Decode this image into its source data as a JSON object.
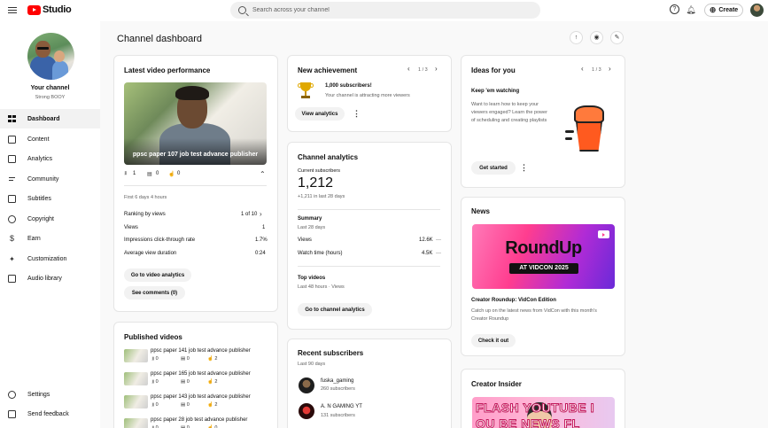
{
  "header": {
    "brand": "Studio",
    "search_placeholder": "Search across your channel",
    "create_label": "Create",
    "brand_color": "#ff0000"
  },
  "sidebar": {
    "channel_title": "Your channel",
    "channel_name": "Strong BOOY",
    "items": [
      {
        "label": "Dashboard",
        "icon": "dashboard-icon"
      },
      {
        "label": "Content",
        "icon": "content-icon"
      },
      {
        "label": "Analytics",
        "icon": "analytics-icon"
      },
      {
        "label": "Community",
        "icon": "community-icon"
      },
      {
        "label": "Subtitles",
        "icon": "subtitles-icon"
      },
      {
        "label": "Copyright",
        "icon": "copyright-icon"
      },
      {
        "label": "Earn",
        "icon": "earn-icon"
      },
      {
        "label": "Customization",
        "icon": "customization-icon"
      },
      {
        "label": "Audio library",
        "icon": "audio-library-icon"
      }
    ],
    "bottom": [
      {
        "label": "Settings",
        "icon": "settings-icon"
      },
      {
        "label": "Send feedback",
        "icon": "feedback-icon"
      }
    ]
  },
  "main": {
    "title": "Channel dashboard"
  },
  "latest_video": {
    "title": "Latest video performance",
    "video_title": "ppsc paper 107 job test advance publisher",
    "views_icon_count": "1",
    "comments_count": "0",
    "likes_count": "0",
    "period": "First 6 days 4 hours",
    "ranking_label": "Ranking by views",
    "ranking_value": "1 of 10",
    "rows": [
      {
        "label": "Views",
        "value": "1"
      },
      {
        "label": "Impressions click-through rate",
        "value": "1.7%"
      },
      {
        "label": "Average view duration",
        "value": "0:24"
      }
    ],
    "go_analytics": "Go to video analytics",
    "see_comments": "See comments (0)"
  },
  "published": {
    "title": "Published videos",
    "items": [
      {
        "title": "ppsc paper 141 job test advance publisher",
        "views": "0",
        "comments": "0",
        "likes": "2"
      },
      {
        "title": "ppsc paper 165 job test advance publisher",
        "views": "0",
        "comments": "0",
        "likes": "2"
      },
      {
        "title": "ppsc paper 143 job test advance publisher",
        "views": "0",
        "comments": "0",
        "likes": "2"
      },
      {
        "title": "ppsc paper 28 job test advance publisher",
        "views": "0",
        "comments": "0",
        "likes": "0"
      }
    ]
  },
  "achievement": {
    "title": "New achievement",
    "pager": "1 / 3",
    "headline": "1,000 subscribers!",
    "desc": "Your channel is attracting more viewers",
    "button": "View analytics"
  },
  "analytics": {
    "title": "Channel analytics",
    "current_label": "Current subscribers",
    "current_value": "1,212",
    "delta": "+1,211 in last 28 days",
    "summary_title": "Summary",
    "summary_period": "Last 28 days",
    "summary_rows": [
      {
        "label": "Views",
        "value": "12.6K",
        "trend": "—"
      },
      {
        "label": "Watch time (hours)",
        "value": "4.5K",
        "trend": "—"
      }
    ],
    "top_title": "Top videos",
    "top_period": "Last 48 hours · Views",
    "button": "Go to channel analytics"
  },
  "subscribers": {
    "title": "Recent subscribers",
    "period": "Last 90 days",
    "items": [
      {
        "name": "fuska_gaming",
        "count": "260 subscribers"
      },
      {
        "name": "A. N GAMING YT",
        "count": "131 subscribers"
      }
    ]
  },
  "ideas": {
    "title": "Ideas for you",
    "pager": "1 / 3",
    "headline": "Keep 'em watching",
    "desc_1": "Want to learn how to keep your",
    "desc_2": "viewers engaged? Learn the power",
    "desc_3": "of scheduling and creating playlists",
    "button": "Get started"
  },
  "news": {
    "title": "News",
    "image_title": "RoundUp",
    "image_sub": "AT VIDCON 2025",
    "headline": "Creator Roundup: VidCon Edition",
    "desc_1": "Catch up on the latest news from VidCon with this month's",
    "desc_2": "Creator Roundup",
    "button": "Check it out"
  },
  "insider": {
    "title": "Creator Insider",
    "line1": "FLASH YOUTUBE I",
    "line2": "OU   BE NEWS FL"
  }
}
